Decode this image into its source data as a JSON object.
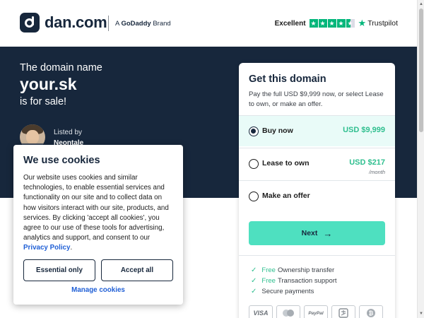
{
  "header": {
    "logo_text": "dan.com",
    "brand_prefix": "A",
    "brand_name": "GoDaddy",
    "brand_suffix": "Brand",
    "trustpilot": {
      "rating_label": "Excellent",
      "logo_text": "Trustpilot",
      "stars": 4.5
    }
  },
  "hero": {
    "line1": "The domain name",
    "domain": "your.sk",
    "line3": "is for sale!",
    "listed_by_label": "Listed by",
    "seller_name": "Neontale"
  },
  "card": {
    "title": "Get this domain",
    "description": "Pay the full USD $9,999 now, or select Lease to own, or make an offer.",
    "options": [
      {
        "label": "Buy now",
        "price": "USD $9,999",
        "sub": "",
        "selected": true
      },
      {
        "label": "Lease to own",
        "price": "USD $217",
        "sub": "/month",
        "selected": false
      },
      {
        "label": "Make an offer",
        "price": "",
        "sub": "",
        "selected": false
      }
    ],
    "next_label": "Next",
    "features": [
      {
        "free": "Free",
        "text": "Ownership transfer"
      },
      {
        "free": "Free",
        "text": "Transaction support"
      },
      {
        "free": "",
        "text": "Secure payments"
      }
    ],
    "payments": [
      "VISA",
      "mastercard-icon",
      "PayPal",
      "alipay-icon",
      "bitcoin-icon"
    ]
  },
  "cookie": {
    "title": "We use cookies",
    "body": "Our website uses cookies and similar technologies, to enable essential services and functionality on our site and to collect data on how visitors interact with our site, products, and services. By clicking 'accept all cookies', you agree to our use of these tools for advertising, analytics and support, and consent to our",
    "policy_link": "Privacy Policy",
    "essential_label": "Essential only",
    "accept_label": "Accept all",
    "manage_label": "Manage cookies"
  },
  "colors": {
    "navy": "#17273c",
    "accent_green": "#2fbf8f",
    "button_teal": "#4ee0c0",
    "link_blue": "#1f5fd6",
    "trustpilot_green": "#00b67a"
  }
}
